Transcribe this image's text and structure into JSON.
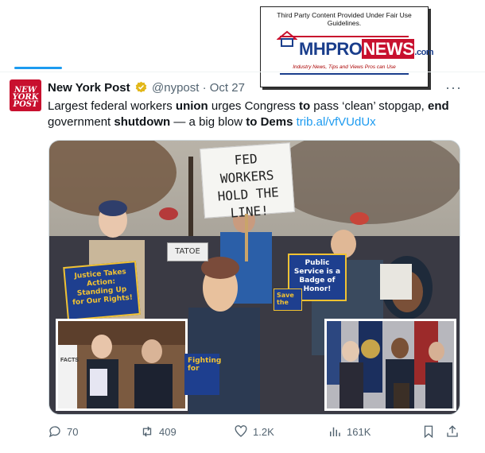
{
  "watermark": {
    "caption": "Third Party Content Provided Under Fair Use Guidelines.",
    "logo_part1": "MHPRO",
    "logo_part2": "NEWS",
    "logo_part3": ".com",
    "tagline": "Industry News, Tips and Views Pros can Use"
  },
  "tweet": {
    "avatar_text": "NEW YORK POST",
    "name": "New York Post",
    "handle": "@nypost",
    "separator": "·",
    "date": "Oct 27",
    "more": "···",
    "text": {
      "t1": "Largest federal workers ",
      "b1": "union",
      "t2": " urges Congress ",
      "b2": "to",
      "t3": " pass ‘clean’ stopgap, ",
      "b3": "end",
      "t4": "government ",
      "b4": "shutdown",
      "t5": " — a big blow ",
      "b5": "to Dems",
      "link": "trib.al/vfVUdUx"
    },
    "image_signs": {
      "main": "FED WORKERS HOLD THE LINE!",
      "blue_left": "Justice Takes Action: Standing Up for Our Rights!",
      "blue_mid": "Public Service is a Badge of Honor!",
      "tatoe": "TATOE",
      "save": "Save the",
      "facts": "FACTS",
      "fighting": "Fighting for"
    },
    "actions": {
      "replies": "70",
      "retweets": "409",
      "likes": "1.2K",
      "views": "161K"
    }
  }
}
